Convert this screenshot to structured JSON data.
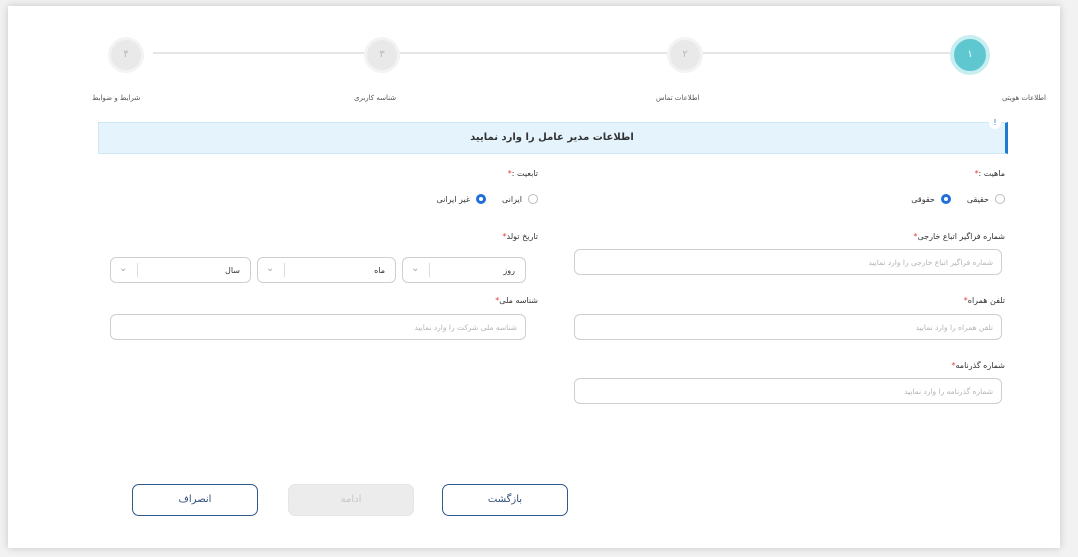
{
  "stepper": {
    "steps": [
      {
        "number": "۱",
        "label": "اطلاعات هویتی",
        "active": true
      },
      {
        "number": "۲",
        "label": "اطلاعات تماس",
        "active": false
      },
      {
        "number": "۳",
        "label": "شناسه کاربری",
        "active": false
      },
      {
        "number": "۴",
        "label": "شرایط و ضوابط",
        "active": false
      }
    ]
  },
  "banner": {
    "text": "اطلاعات مدیر عامل را وارد نمایید",
    "icon": "info-icon",
    "icon_glyph": "!"
  },
  "form": {
    "nature": {
      "label": "ماهیت :",
      "required_mark": "*",
      "options": [
        {
          "label": "حقیقی",
          "checked": false
        },
        {
          "label": "حقوقی",
          "checked": true
        }
      ]
    },
    "nationality": {
      "label": "تابعیت :",
      "required_mark": "*",
      "options": [
        {
          "label": "ایرانی",
          "checked": false
        },
        {
          "label": "غیر ایرانی",
          "checked": true
        }
      ]
    },
    "foreign_id": {
      "label": "شماره فراگیر اتباع خارجی",
      "required_mark": "*",
      "placeholder": "شماره فراگیر اتباع خارجی را وارد نمایید",
      "value": ""
    },
    "birth_date": {
      "label": "تاریخ تولد",
      "required_mark": "*",
      "day": "روز",
      "month": "ماه",
      "year": "سال"
    },
    "mobile": {
      "label": "تلفن همراه",
      "required_mark": "*",
      "placeholder": "تلفن همراه را وارد نمایید",
      "value": ""
    },
    "national_id": {
      "label": "شناسه ملی",
      "required_mark": "*",
      "placeholder": "شناسه ملی شرکت را وارد نمایید",
      "value": ""
    },
    "passport": {
      "label": "شماره گذرنامه",
      "required_mark": "*",
      "placeholder": "شماره گذرنامه را وارد نمایید",
      "value": ""
    }
  },
  "buttons": {
    "back": "بازگشت",
    "continue": "ادامه",
    "cancel": "انصراف"
  },
  "colors": {
    "active_step": "#5ec7cf",
    "radio_checked": "#1e6fdb",
    "required": "#e23d3d",
    "banner_bg": "#e4f3fc",
    "banner_accent": "#1e7cd0"
  }
}
